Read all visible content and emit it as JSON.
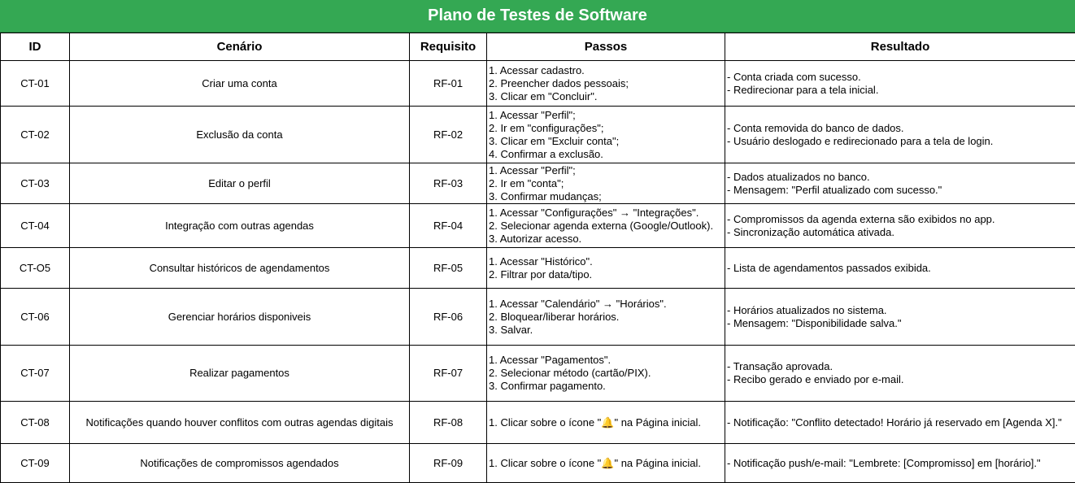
{
  "title": "Plano de Testes de Software",
  "headers": {
    "id": "ID",
    "cenario": "Cenário",
    "requisito": "Requisito",
    "passos": "Passos",
    "resultado": "Resultado"
  },
  "rows": [
    {
      "id": "CT-01",
      "cenario": "Criar uma conta",
      "requisito": "RF-01",
      "passos": [
        "1. Acessar cadastro.",
        "2. Preencher dados pessoais;",
        "3. Clicar em \"Concluir\"."
      ],
      "resultado": [
        "- Conta criada com sucesso.",
        "- Redirecionar para a tela inicial."
      ]
    },
    {
      "id": "CT-02",
      "cenario": "Exclusão da conta",
      "requisito": "RF-02",
      "passos": [
        "1. Acessar \"Perfil\";",
        "2. Ir em \"configurações\";",
        "3. Clicar em \"Excluir conta\";",
        "4. Confirmar a exclusão."
      ],
      "resultado": [
        "- Conta removida do banco de dados.",
        "- Usuário deslogado e redirecionado para a tela de login."
      ]
    },
    {
      "id": "CT-03",
      "cenario": "Editar o perfil",
      "requisito": "RF-03",
      "passos": [
        "1. Acessar \"Perfil\";",
        "2. Ir em \"conta\";",
        "3. Confirmar mudanças;"
      ],
      "resultado": [
        "- Dados atualizados no banco.",
        "- Mensagem: \"Perfil atualizado com sucesso.\""
      ]
    },
    {
      "id": "CT-04",
      "cenario": "Integração com outras agendas",
      "requisito": "RF-04",
      "passos": [
        "1. Acessar \"Configurações\" → \"Integrações\".",
        "2. Selecionar agenda externa (Google/Outlook).",
        "3. Autorizar acesso."
      ],
      "resultado": [
        "- Compromissos da agenda externa são exibidos no app.",
        "- Sincronização automática ativada."
      ]
    },
    {
      "id": "CT-O5",
      "cenario": "Consultar históricos de agendamentos",
      "requisito": "RF-05",
      "passos": [
        "1. Acessar \"Histórico\".",
        "2. Filtrar por data/tipo."
      ],
      "resultado": [
        "- Lista de agendamentos passados exibida."
      ]
    },
    {
      "id": "CT-06",
      "cenario": "Gerenciar horários disponiveis",
      "requisito": "RF-06",
      "passos": [
        "1. Acessar \"Calendário\" → \"Horários\".",
        "2. Bloquear/liberar horários.",
        "3. Salvar."
      ],
      "resultado": [
        "- Horários atualizados no sistema.",
        "- Mensagem: \"Disponibilidade salva.\""
      ]
    },
    {
      "id": "CT-07",
      "cenario": "Realizar pagamentos",
      "requisito": "RF-07",
      "passos": [
        "1. Acessar \"Pagamentos\".",
        "2. Selecionar método (cartão/PIX).",
        "3. Confirmar pagamento."
      ],
      "resultado": [
        "- Transação aprovada.",
        "- Recibo gerado e enviado por e-mail."
      ]
    },
    {
      "id": "CT-08",
      "cenario": "Notificações quando houver conflitos com outras agendas digitais",
      "requisito": "RF-08",
      "passos": [
        "1. Clicar sobre o ícone \"🔔\" na Página inicial."
      ],
      "resultado": [
        "- Notificação: \"Conflito detectado! Horário já reservado em [Agenda X].\""
      ]
    },
    {
      "id": "CT-09",
      "cenario": "Notificações de compromissos agendados",
      "requisito": "RF-09",
      "passos": [
        "1. Clicar sobre o ícone \"🔔\" na Página inicial."
      ],
      "resultado": [
        "- Notificação push/e-mail: \"Lembrete: [Compromisso] em [horário].\""
      ]
    }
  ]
}
